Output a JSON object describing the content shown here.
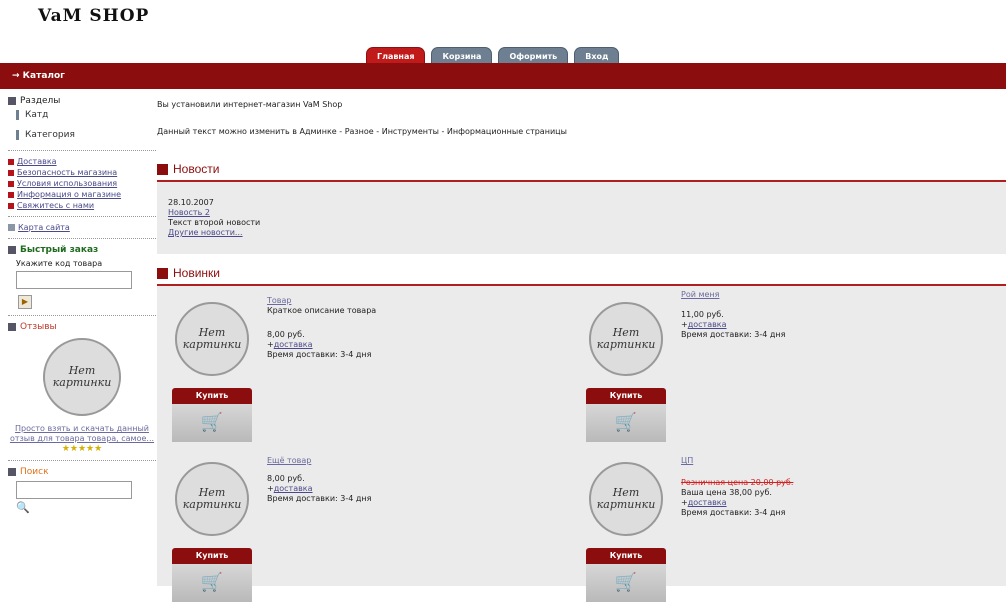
{
  "logo": "VaM SHOP",
  "tabs": [
    "Главная",
    "Корзина",
    "Оформить",
    "Вход"
  ],
  "catalog_label": "→ Каталог",
  "sidebar": {
    "sections_title": "Разделы",
    "categories": [
      "Катд",
      "Категория"
    ],
    "info_links": [
      "Доставка",
      "Безопасность магазина",
      "Условия использования",
      "Информация о магазине",
      "Свяжитесь с нами"
    ],
    "sitemap": "Карта сайта",
    "quick_order_title": "Быстрый заказ",
    "quick_order_label": "Укажите код товара",
    "reviews_title": "Отзывы",
    "no_image_line1": "Нет",
    "no_image_line2": "картинки",
    "review_text": "Просто взять и скачать данный отзыв для товара товара, самое...",
    "review_stars": "★★★★★",
    "search_title": "Поиск",
    "search_icon": "🔍"
  },
  "main": {
    "welcome": "Вы установили интернет-магазин VaM Shop",
    "welcome2": "Данный текст можно изменить в Админке - Разное - Инструменты - Информационные страницы",
    "news_title": "Новости",
    "news_date": "28.10.2007",
    "news_link": "Новость 2",
    "news_text": "Текст второй новости",
    "news_more": "Другие новости...",
    "new_products_title": "Новинки"
  },
  "products": [
    {
      "name": "Товар",
      "short": "Краткое описание товара",
      "price": "8,00 руб.",
      "delivery_link": "доставка",
      "delivery_time": "Время доставки: 3-4 дня",
      "old_price": "",
      "buy": "Купить"
    },
    {
      "name": "Рой меня",
      "short": "",
      "price": "11,00 руб.",
      "delivery_link": "доставка",
      "delivery_time": "Время доставки: 3-4 дня",
      "old_price": "",
      "buy": "Купить"
    },
    {
      "name": "Ещё товар",
      "short": "",
      "price": "8,00 руб.",
      "delivery_link": "доставка",
      "delivery_time": "Время доставки: 3-4 дня",
      "old_price": "",
      "buy": "Купить"
    },
    {
      "name": "ЦП",
      "short": "",
      "price": "Ваша цена 38,00 руб.",
      "delivery_link": "доставка",
      "delivery_time": "Время доставки: 3-4 дня",
      "old_price": "Розничная цена 20,00 руб.",
      "buy": "Купить"
    }
  ]
}
